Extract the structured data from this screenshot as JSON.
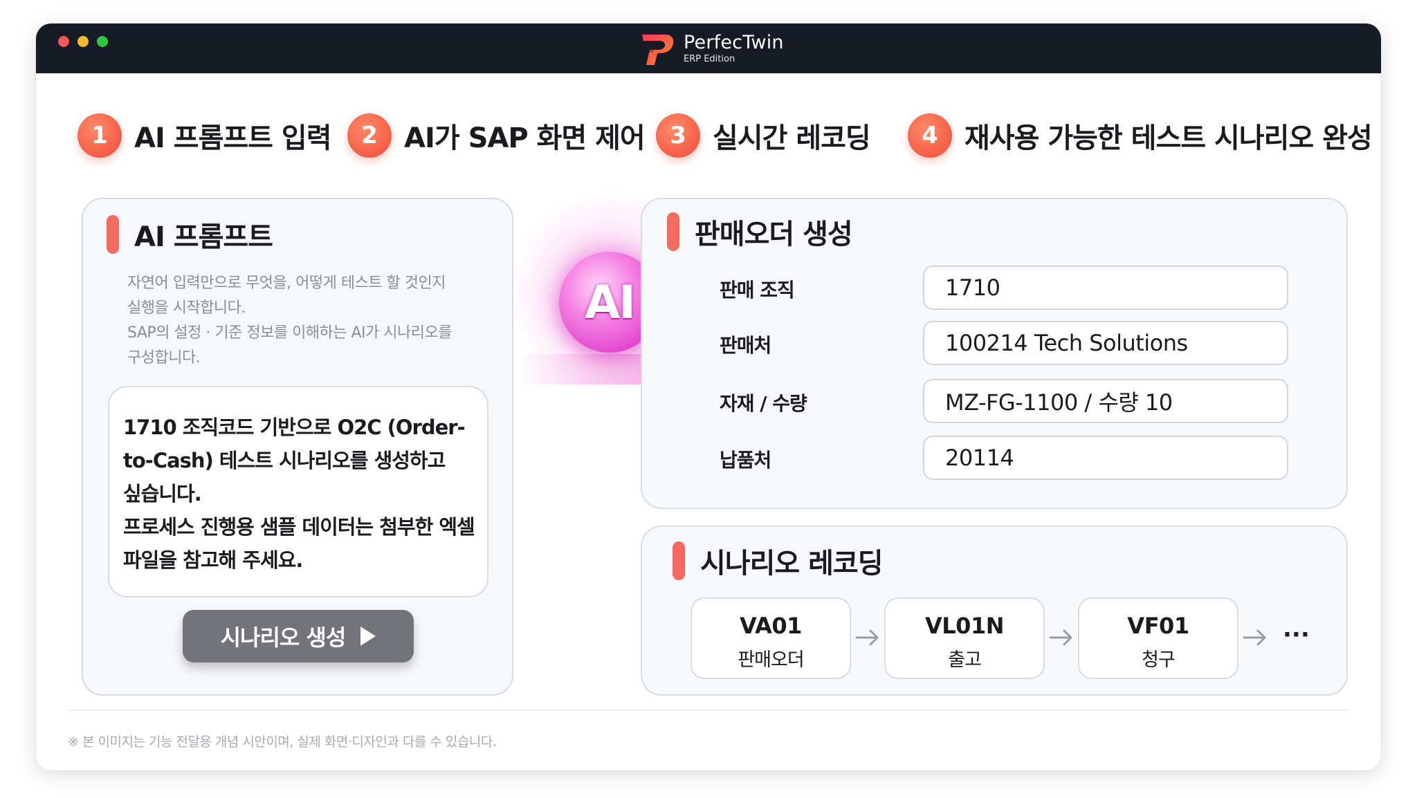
{
  "brand": {
    "name": "PerfecTwin",
    "edition": "ERP Edition"
  },
  "steps": [
    {
      "number": "1",
      "label": "AI 프롬프트 입력"
    },
    {
      "number": "2",
      "label": "AI가 SAP 화면 제어"
    },
    {
      "number": "3",
      "label": "실시간 레코딩"
    },
    {
      "number": "4",
      "label": "재사용 가능한 테스트 시나리오 완성"
    }
  ],
  "prompt_panel": {
    "title": "AI 프롬프트",
    "description_lines": [
      "자연어 입력만으로 무엇을, 어떻게 테스트 할 것인지",
      "실행을 시작합니다.",
      "SAP의 설정 · 기준 정보를 이해하는 AI가 시나리오를",
      "구성합니다."
    ],
    "prompt_lines": [
      "1710 조직코드 기반으로 O2C (Order-",
      "to-Cash) 테스트 시나리오를 생성하고",
      "싶습니다.",
      "프로세스 진행용 샘플 데이터는 첨부한 엑셀",
      "파일을 참고해 주세요."
    ],
    "button_label": "시나리오 생성"
  },
  "ai_badge": "AI",
  "sales_order_panel": {
    "title": "판매오더 생성",
    "fields": [
      {
        "label": "판매 조직",
        "value": "1710"
      },
      {
        "label": "판매처",
        "value": "100214 Tech Solutions"
      },
      {
        "label": "자재 / 수량",
        "value": "MZ-FG-1100 / 수량 10"
      },
      {
        "label": "납품처",
        "value": "20114"
      }
    ]
  },
  "recording_panel": {
    "title": "시나리오 레코딩",
    "tcodes": [
      {
        "code": "VA01",
        "name": "판매오더"
      },
      {
        "code": "VL01N",
        "name": "출고"
      },
      {
        "code": "VF01",
        "name": "청구"
      }
    ],
    "more": "···"
  },
  "footnote": "※ 본 이미지는 기능 전달용 개념 시안이며, 실제 화면·디자인과 다를 수 있습니다.",
  "colors": {
    "accent": "#f66a5f",
    "ai_pink": "#e03fcb",
    "titlebar": "#161b26",
    "button": "#727479"
  }
}
